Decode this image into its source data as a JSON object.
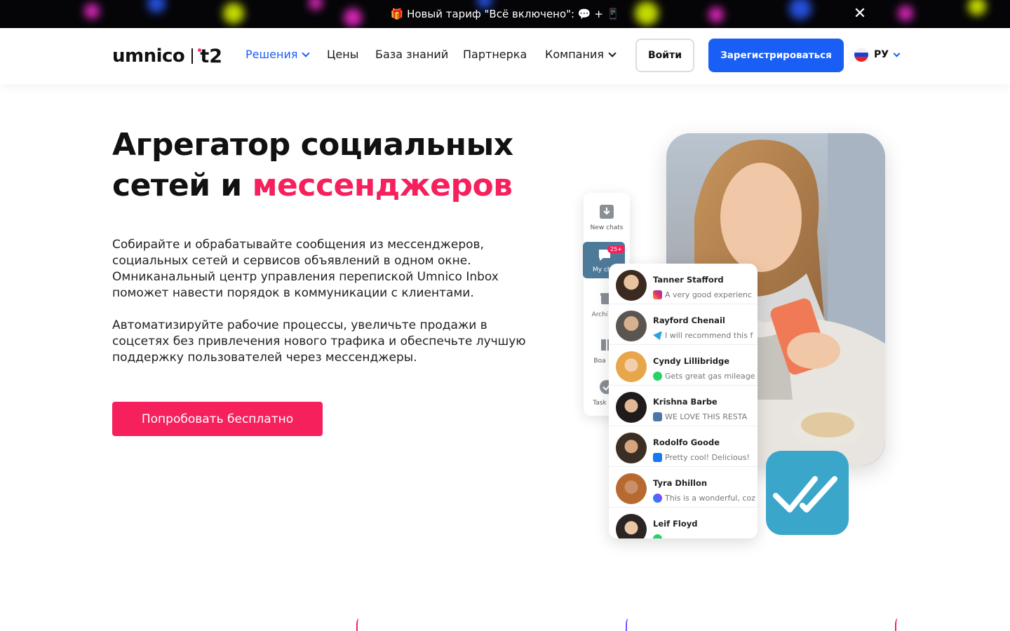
{
  "promo": {
    "text": "🎁 Новый тариф \"Всё включено\": 💬 + 📱",
    "close_icon": "close-icon"
  },
  "header": {
    "logo_main": "umnico",
    "logo_partner": "t2",
    "nav": [
      {
        "label": "Решения",
        "dropdown": true,
        "active": true
      },
      {
        "label": "Цены",
        "dropdown": false,
        "active": false
      },
      {
        "label": "База знаний",
        "dropdown": false,
        "active": false
      },
      {
        "label": "Партнерка",
        "dropdown": false,
        "active": false
      },
      {
        "label": "Компания",
        "dropdown": true,
        "active": false
      }
    ],
    "login_label": "Войти",
    "register_label": "Зарегистрироваться",
    "lang_label": "РУ"
  },
  "hero": {
    "title_line1": "Агрегатор социальных",
    "title_line2_plain": "сетей и ",
    "title_line2_accent": "мессенджеров",
    "paragraph1": "Собирайте и обрабатывайте сообщения из мессенджеров, социальных сетей и сервисов объявлений в одном окне. Омниканальный центр управления перепиской Umnico Inbox поможет навести порядок в коммуникации с клиентами.",
    "paragraph2": "Автоматизируйте рабочие процессы, увеличьте продажи в соцсетях без привлечения нового трафика и обеспечьте лучшую поддержку пользователей через мессенджеры.",
    "cta_label": "Попробовать бесплатно"
  },
  "illustration": {
    "sidebar": [
      {
        "label": "New chats",
        "icon": "inbox-download-icon"
      },
      {
        "label": "My ch",
        "icon": "chat-bubble-icon",
        "badge": "25+"
      },
      {
        "label": "Archi",
        "icon": "archive-icon"
      },
      {
        "label": "Boa",
        "icon": "board-icon"
      },
      {
        "label": "Task",
        "icon": "check-circle-icon"
      }
    ],
    "chats": [
      {
        "name": "Tanner Stafford",
        "message": "A very good experienc",
        "network": "instagram"
      },
      {
        "name": "Rayford Chenail",
        "message": "I will recommend this f",
        "network": "telegram"
      },
      {
        "name": "Cyndy Lillibridge",
        "message": "Gets great gas mileage",
        "network": "whatsapp"
      },
      {
        "name": "Krishna Barbe",
        "message": "WE LOVE THIS RESTA",
        "network": "vk"
      },
      {
        "name": "Rodolfo Goode",
        "message": "Pretty cool! Delicious!",
        "network": "facebook"
      },
      {
        "name": "Tyra Dhillon",
        "message": "This is a wonderful, coz",
        "network": "messenger"
      },
      {
        "name": "Leif Floyd",
        "message": "",
        "network": "whatsapp"
      }
    ]
  },
  "colors": {
    "brand_blue": "#1a5ff5",
    "accent_pink": "#f5205c",
    "check_tile": "#3aa6c9"
  }
}
